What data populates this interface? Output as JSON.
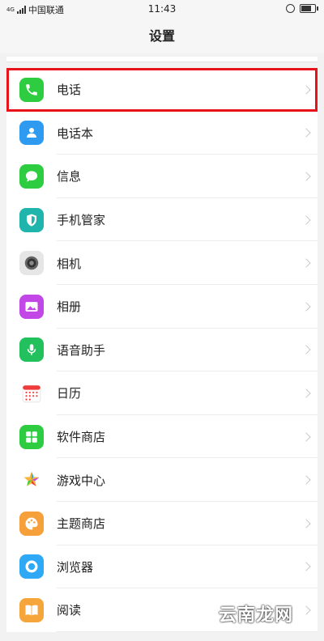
{
  "status_bar": {
    "carrier": "中国联通",
    "signal_label": "4G",
    "time": "11:43"
  },
  "header": {
    "title": "设置"
  },
  "items": [
    {
      "label": "电话",
      "icon": "phone-icon",
      "color": "#2ecc40",
      "selected": true
    },
    {
      "label": "电话本",
      "icon": "contacts-icon",
      "color": "#2f9bf0"
    },
    {
      "label": "信息",
      "icon": "message-icon",
      "color": "#2ecc40"
    },
    {
      "label": "手机管家",
      "icon": "shield-icon",
      "color": "#1fb5ad"
    },
    {
      "label": "相机",
      "icon": "camera-icon",
      "color": "#e6e6e6"
    },
    {
      "label": "相册",
      "icon": "gallery-icon",
      "color": "#c247e6"
    },
    {
      "label": "语音助手",
      "icon": "microphone-icon",
      "color": "#22c15e"
    },
    {
      "label": "日历",
      "icon": "calendar-icon",
      "color": "#ffffff"
    },
    {
      "label": "软件商店",
      "icon": "app-store-icon",
      "color": "#2ecc40"
    },
    {
      "label": "游戏中心",
      "icon": "game-center-icon",
      "color": "#ffffff"
    },
    {
      "label": "主题商店",
      "icon": "theme-store-icon",
      "color": "#f5a03a"
    },
    {
      "label": "浏览器",
      "icon": "browser-icon",
      "color": "#2fa8f5"
    },
    {
      "label": "阅读",
      "icon": "reading-icon",
      "color": "#f5a53a"
    }
  ],
  "watermark": "云南龙网"
}
